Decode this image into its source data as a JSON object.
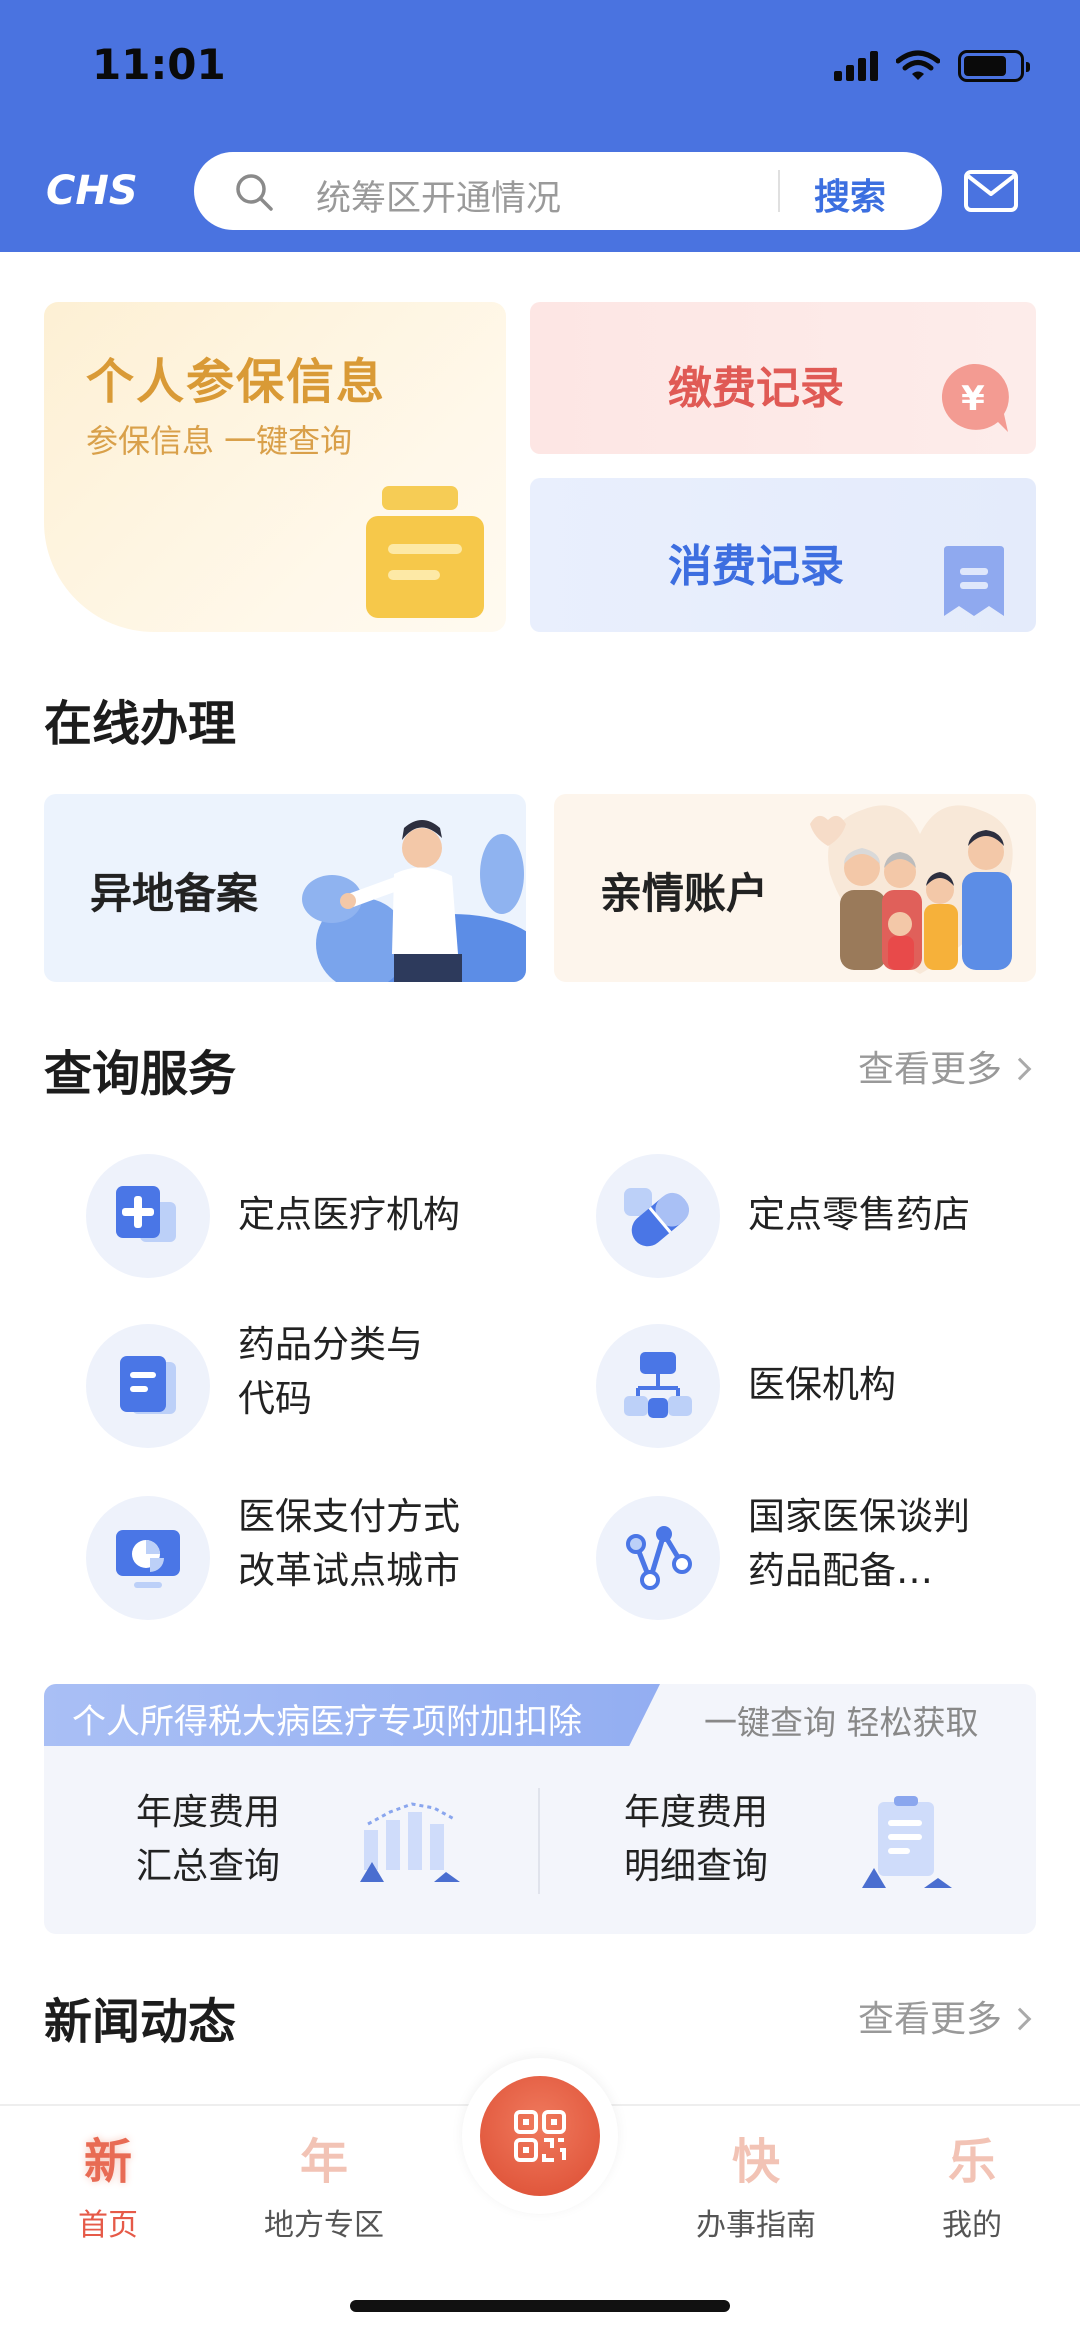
{
  "status_bar": {
    "time": "11:01"
  },
  "header": {
    "logo_text": "CHS",
    "search_placeholder": "统筹区开通情况",
    "search_button": "搜索"
  },
  "top_cards": {
    "personal": {
      "title": "个人参保信息",
      "subtitle": "参保信息 一键查询"
    },
    "payment": {
      "title": "缴费记录",
      "icon_glyph": "¥"
    },
    "consumption": {
      "title": "消费记录"
    }
  },
  "online": {
    "section_title": "在线办理",
    "cards": [
      {
        "label": "异地备案"
      },
      {
        "label": "亲情账户"
      }
    ]
  },
  "query": {
    "section_title": "查询服务",
    "more": "查看更多",
    "items": [
      {
        "label": "定点医疗机构",
        "icon": "hospital-cross-icon"
      },
      {
        "label": "定点零售药店",
        "icon": "pill-capsule-icon"
      },
      {
        "label": "药品分类与\n代码",
        "icon": "document-icon"
      },
      {
        "label": "医保机构",
        "icon": "org-chart-icon"
      },
      {
        "label": "医保支付方式\n改革试点城市",
        "icon": "monitor-pie-icon"
      },
      {
        "label": "国家医保谈判\n药品配备…",
        "icon": "network-nodes-icon"
      }
    ]
  },
  "tax": {
    "banner": "个人所得税大病医疗专项附加扣除",
    "hint": "一键查询 轻松获取",
    "cols": [
      {
        "label": "年度费用\n汇总查询"
      },
      {
        "label": "年度费用\n明细查询"
      }
    ]
  },
  "news": {
    "section_title": "新闻动态",
    "more": "查看更多"
  },
  "tabbar": {
    "tabs": [
      {
        "glyph": "新",
        "label": "首页"
      },
      {
        "glyph": "年",
        "label": "地方专区"
      },
      {
        "glyph": "快",
        "label": "办事指南"
      },
      {
        "glyph": "乐",
        "label": "我的"
      }
    ]
  },
  "colors": {
    "primary": "#4a73e0",
    "accent_red": "#e65a48",
    "gold": "#d99a36"
  }
}
